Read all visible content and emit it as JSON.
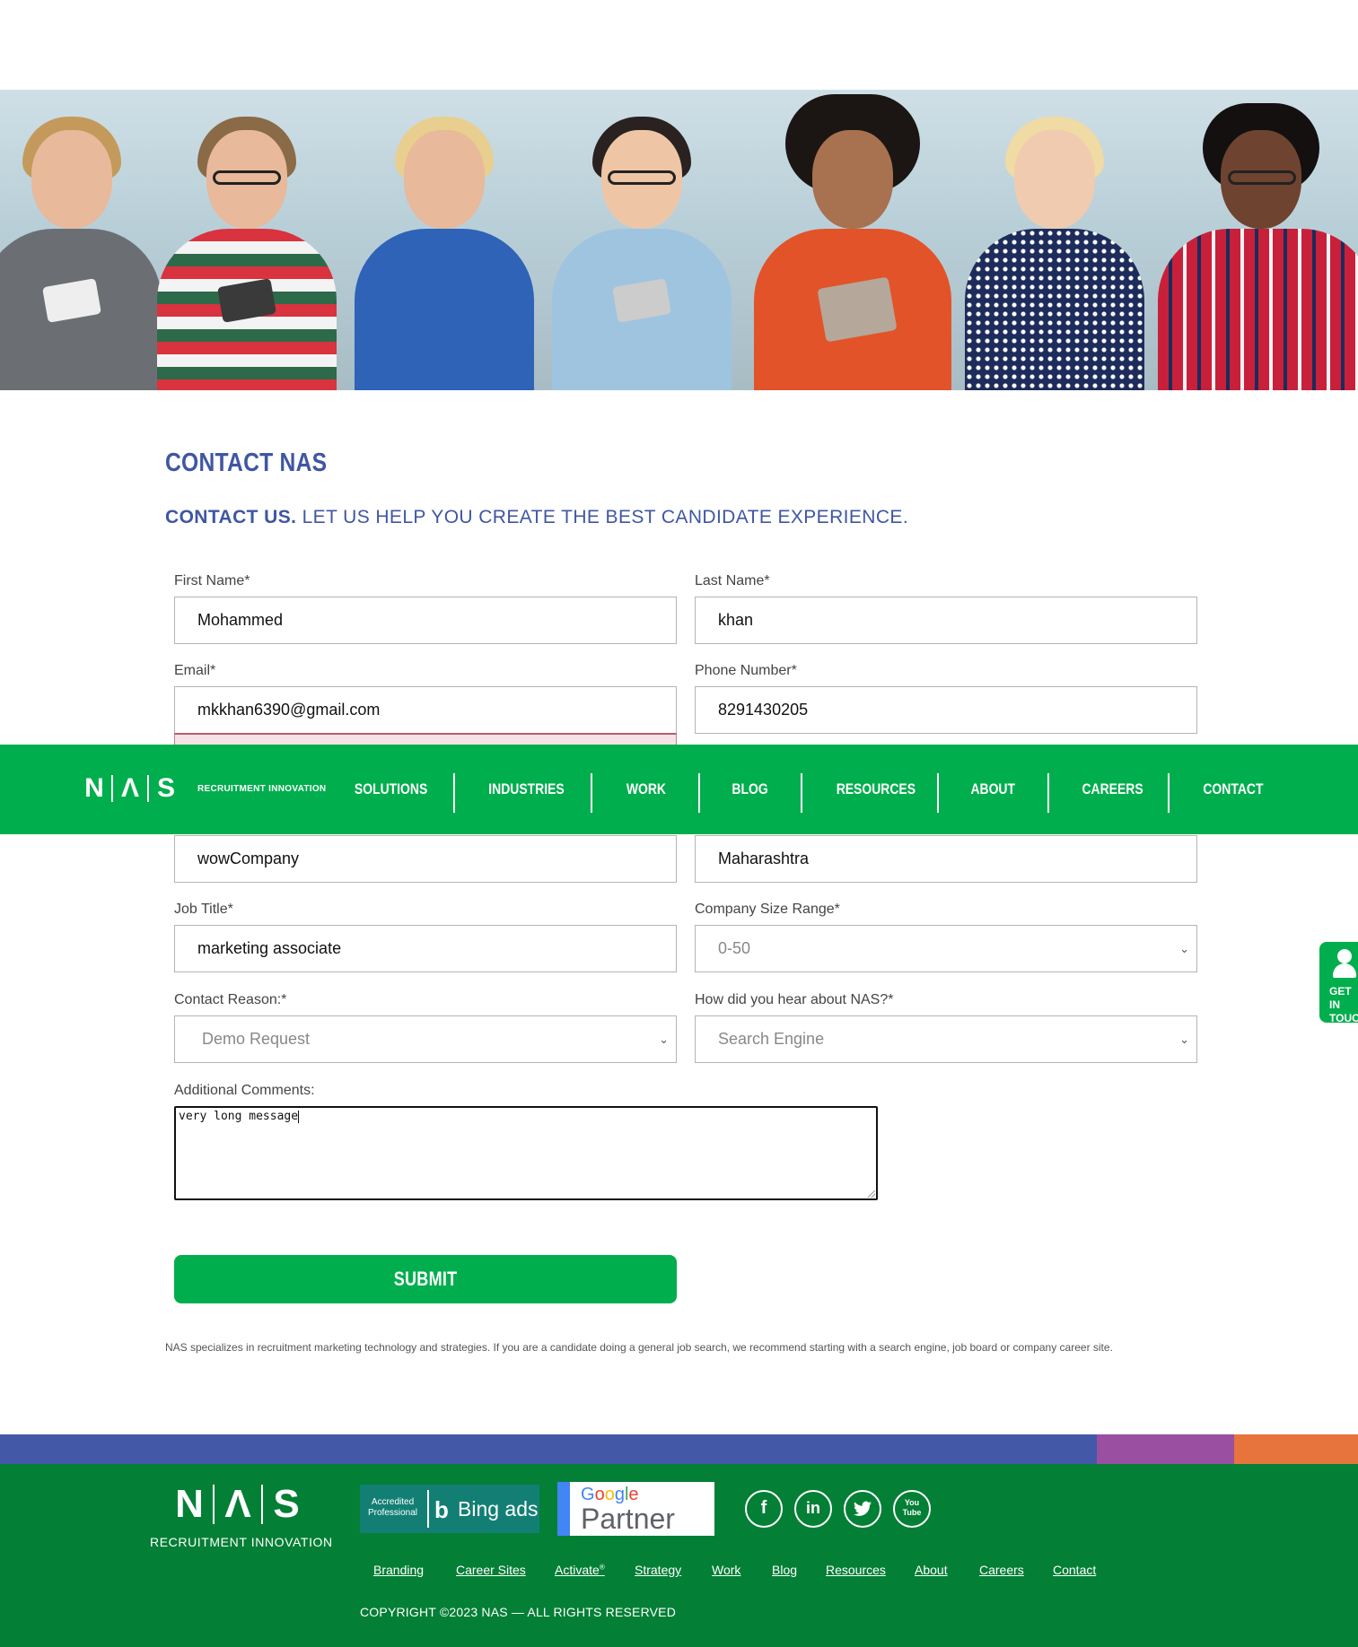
{
  "contact": {
    "page_title": "CONTACT NAS",
    "subtitle_bold": "CONTACT US.",
    "subtitle_rest": " LET US HELP YOU CREATE THE BEST CANDIDATE EXPERIENCE."
  },
  "form": {
    "first_name": {
      "label": "First Name*",
      "value": "Mohammed"
    },
    "last_name": {
      "label": "Last Name*",
      "value": "khan"
    },
    "email": {
      "label": "Email*",
      "value": "mkkhan6390@gmail.com"
    },
    "phone": {
      "label": "Phone Number*",
      "value": "8291430205"
    },
    "company": {
      "value": "wowCompany"
    },
    "state": {
      "value": "Maharashtra"
    },
    "job_title": {
      "label": "Job Title*",
      "value": "marketing associate"
    },
    "company_size": {
      "label": "Company Size Range*",
      "value": "0-50"
    },
    "contact_reason": {
      "label": "Contact Reason:*",
      "value": "Demo Request"
    },
    "hear_about": {
      "label": "How did you hear about NAS?*",
      "value": "Search Engine"
    },
    "comments": {
      "label": "Additional Comments:",
      "value": "very long message"
    },
    "submit_label": "SUBMIT",
    "disclaimer": "NAS specializes in recruitment marketing technology and strategies. If you are a candidate doing a general job search, we recommend starting with a search engine, job board or company career site."
  },
  "nav": {
    "logo_letters": [
      "N",
      "Λ",
      "S"
    ],
    "tagline": "RECRUITMENT INNOVATION",
    "items": [
      "SOLUTIONS",
      "INDUSTRIES",
      "WORK",
      "BLOG",
      "RESOURCES",
      "ABOUT",
      "CAREERS",
      "CONTACT"
    ]
  },
  "touch_tab": {
    "line1": "GET IN",
    "line2": "TOUCH"
  },
  "footer": {
    "logo_letters": [
      "N",
      "Λ",
      "S"
    ],
    "tagline": "RECRUITMENT INNOVATION",
    "bing": {
      "accredited": "Accredited",
      "professional": "Professional",
      "icon": "b",
      "ads": "Bing ads"
    },
    "google": {
      "brand": "Google",
      "partner": "Partner"
    },
    "social": [
      {
        "name": "facebook-icon",
        "glyph": "f"
      },
      {
        "name": "linkedin-icon",
        "glyph": "in"
      },
      {
        "name": "twitter-icon",
        "glyph": "t"
      },
      {
        "name": "youtube-icon",
        "glyph": "You Tube"
      }
    ],
    "links": [
      "Branding",
      "Career Sites",
      "Activate",
      "Strategy",
      "Work",
      "Blog",
      "Resources",
      "About",
      "Careers",
      "Contact"
    ],
    "activate_mark": "®",
    "copyright": "COPYRIGHT ©2023 NAS — ALL RIGHTS RESERVED"
  },
  "colors": {
    "brand_green": "#00ae4d",
    "footer_green": "#047f36",
    "heading_blue": "#3f56a3",
    "bar_blue": "#4359a8",
    "bar_purple": "#9a4fa0",
    "bar_orange": "#e7743c"
  }
}
